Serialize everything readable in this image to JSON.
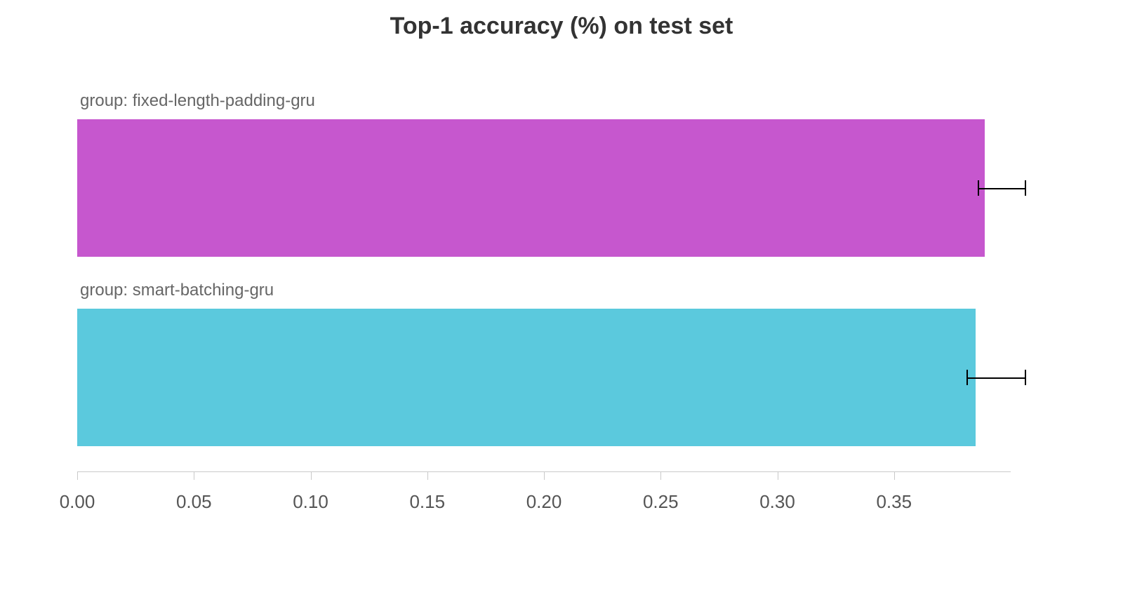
{
  "chart_data": {
    "type": "bar",
    "title": "Top-1 accuracy (%) on test set",
    "orientation": "horizontal",
    "xlim": [
      0.0,
      0.4
    ],
    "xticks": [
      "0.00",
      "0.05",
      "0.10",
      "0.15",
      "0.20",
      "0.25",
      "0.30",
      "0.35"
    ],
    "categories": [
      "group: fixed-length-padding-gru",
      "group: smart-batching-gru"
    ],
    "values": [
      0.389,
      0.385
    ],
    "error_low": [
      0.003,
      0.004
    ],
    "error_high": [
      0.017,
      0.021
    ],
    "colors": [
      "#c657ce",
      "#5bc9dd"
    ]
  }
}
